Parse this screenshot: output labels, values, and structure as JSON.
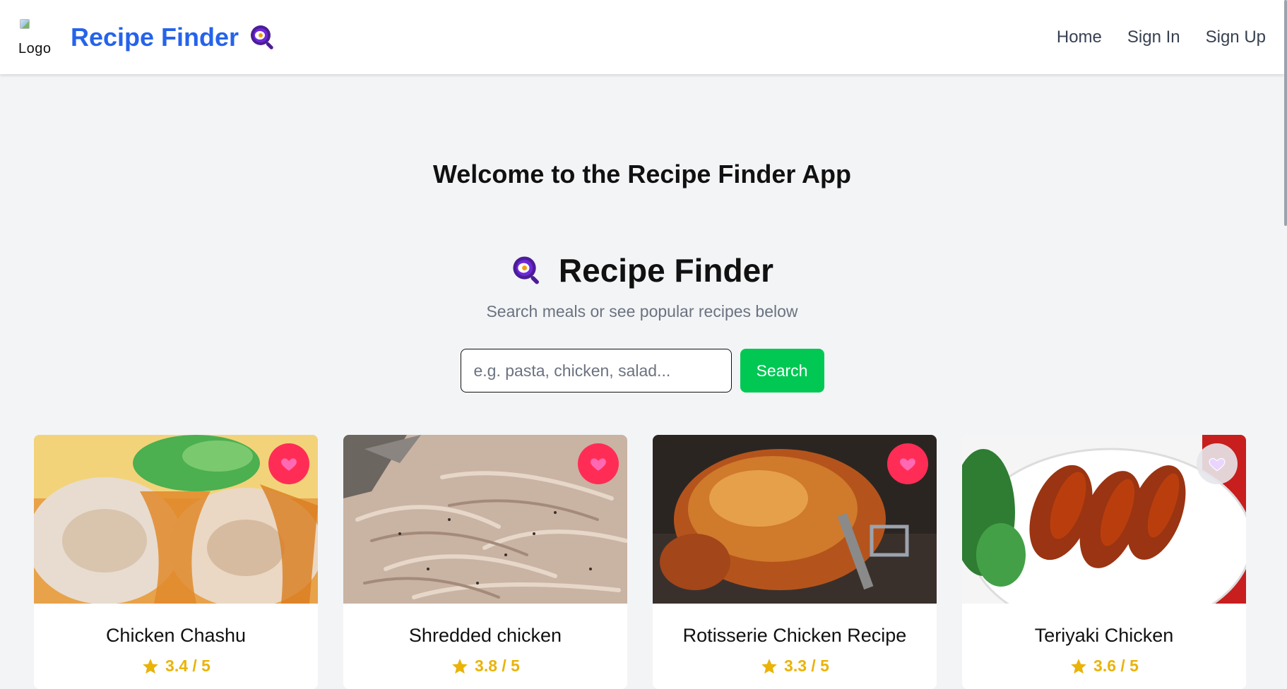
{
  "navbar": {
    "logo_alt": "Logo",
    "brand": "Recipe Finder",
    "links": [
      "Home",
      "Sign In",
      "Sign Up"
    ]
  },
  "welcome": "Welcome to the Recipe Finder App",
  "hero": {
    "title": "Recipe Finder",
    "subtitle": "Search meals or see popular recipes below"
  },
  "search": {
    "placeholder": "e.g. pasta, chicken, salad...",
    "value": "",
    "button_label": "Search"
  },
  "recipes": [
    {
      "title": "Chicken Chashu",
      "rating": "3.4 / 5",
      "favorited": true
    },
    {
      "title": "Shredded chicken",
      "rating": "3.8 / 5",
      "favorited": true
    },
    {
      "title": "Rotisserie Chicken Recipe",
      "rating": "3.3 / 5",
      "favorited": true
    },
    {
      "title": "Teriyaki Chicken",
      "rating": "3.6 / 5",
      "favorited": false
    }
  ],
  "colors": {
    "brand": "#2563eb",
    "search_button": "#00c853",
    "favorite_on": "#ff2d55",
    "rating": "#eab308",
    "background": "#f3f4f6"
  },
  "icons": {
    "brand": "frying-pan-egg-icon",
    "favorite": "heart-icon",
    "rating": "star-icon"
  }
}
